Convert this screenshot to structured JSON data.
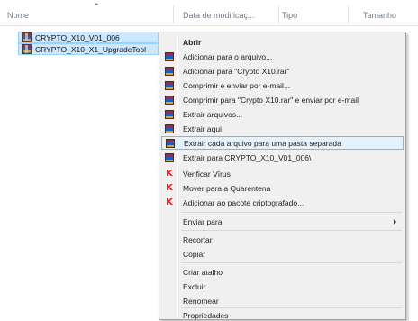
{
  "columns": {
    "name": "Nome",
    "date": "Data de modificaç...",
    "type": "Tipo",
    "size": "Tamanho"
  },
  "files": [
    {
      "name": "CRYPTO_X10_V01_006",
      "icon": "winrar-archive-icon"
    },
    {
      "name": "CRYPTO_X10_X1_UpgradeTool",
      "icon": "winrar-archive-icon"
    }
  ],
  "menu": {
    "open": "Abrir",
    "items": [
      {
        "label": "Adicionar para o arquivo...",
        "icon": "winrar-icon"
      },
      {
        "label": "Adicionar para \"Crypto X10.rar\"",
        "icon": "winrar-icon"
      },
      {
        "label": "Comprimir e enviar por e-mail...",
        "icon": "winrar-icon"
      },
      {
        "label": "Comprimir para \"Crypto X10.rar\" e enviar por e-mail",
        "icon": "winrar-icon"
      },
      {
        "label": "Extrair arquivos...",
        "icon": "winrar-icon"
      },
      {
        "label": "Extrair aqui",
        "icon": "winrar-icon"
      },
      {
        "label": "Extrair cada arquivo para uma pasta separada",
        "icon": "winrar-icon"
      },
      {
        "label": "Extrair para CRYPTO_X10_V01_006\\",
        "icon": "winrar-icon"
      },
      {
        "label": "Verificar Vírus",
        "icon": "kaspersky-icon"
      },
      {
        "label": "Mover para a Quarentena",
        "icon": "kaspersky-icon"
      },
      {
        "label": "Adicionar ao pacote criptografado...",
        "icon": "kaspersky-icon"
      }
    ],
    "send_to": "Enviar para",
    "cut": "Recortar",
    "copy": "Copiar",
    "create_shortcut": "Criar atalho",
    "delete": "Excluir",
    "rename": "Renomear",
    "properties": "Propriedades"
  }
}
